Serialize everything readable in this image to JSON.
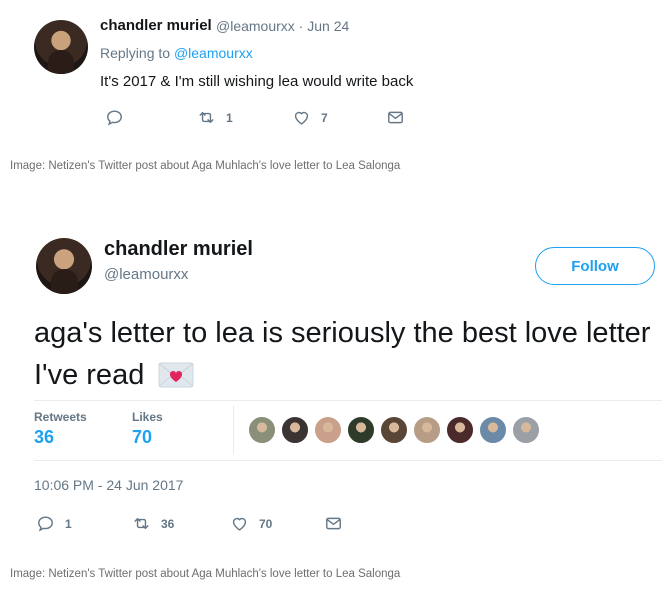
{
  "tweet1": {
    "name": "chandler muriel",
    "handle_date": "@leamourxx · Jun 24",
    "reply_prefix": "Replying to",
    "reply_mention": "@leamourxx",
    "text": "It's 2017 & I'm still wishing lea would write back",
    "retweets": "1",
    "likes": "7"
  },
  "caption1": "Image: Netizen's Twitter post about Aga Muhlach's love letter to Lea Salonga",
  "tweet2": {
    "name": "chandler muriel",
    "handle": "@leamourxx",
    "follow_label": "Follow",
    "text": "aga's letter to lea is seriously the best love letter I've read",
    "retweets_label": "Retweets",
    "retweets": "36",
    "likes_label": "Likes",
    "likes": "70",
    "timestamp": "10:06 PM - 24 Jun 2017",
    "reply_count": "1",
    "retweet_count": "36",
    "like_count": "70",
    "liker_colors": [
      "#8a8f7a",
      "#3c3333",
      "#c9a08a",
      "#2e3a2a",
      "#5a4636",
      "#b79d86",
      "#4a2a2a",
      "#6a8aa8",
      "#9aa0a6"
    ]
  },
  "caption2": "Image: Netizen's Twitter post about Aga Muhlach's love letter to Lea Salonga",
  "colors": {
    "accent": "#1da1f2",
    "muted": "#657786",
    "text": "#14171a",
    "envelope_heart": "#e0245e"
  },
  "icons": [
    "reply-icon",
    "retweet-icon",
    "like-icon",
    "message-icon",
    "love-letter-envelope-icon"
  ]
}
